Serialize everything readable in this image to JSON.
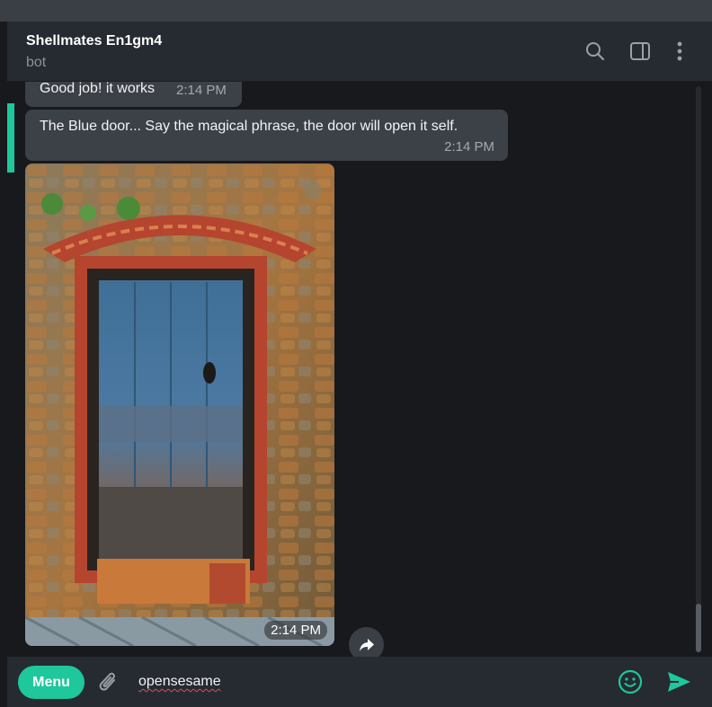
{
  "header": {
    "title": "Shellmates En1gm4",
    "status": "bot",
    "icons": [
      "search-icon",
      "sidebar-toggle-icon",
      "more-vertical-icon"
    ]
  },
  "messages": [
    {
      "text": "Good job! it works",
      "time": "2:14 PM"
    },
    {
      "text": "The Blue door... Say the magical phrase, the door will open it self.",
      "time": "2:14 PM"
    },
    {
      "type": "photo",
      "time": "2:14 PM"
    }
  ],
  "composer": {
    "menu_label": "Menu",
    "input_value": "opensesame",
    "icons": [
      "paperclip-icon",
      "emoji-icon",
      "send-icon"
    ]
  },
  "colors": {
    "accent": "#1ec79c",
    "bubble": "#3c4047",
    "background": "#17191c",
    "header": "#262a31"
  }
}
